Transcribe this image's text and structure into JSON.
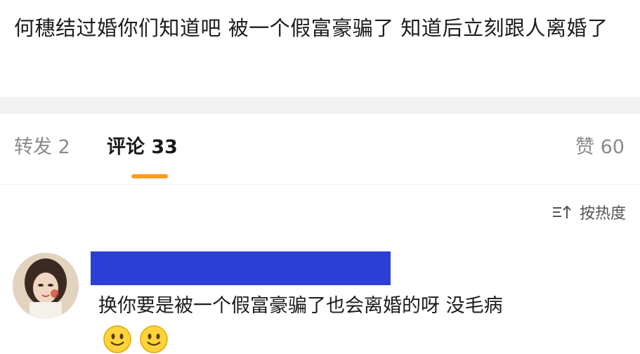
{
  "post": {
    "text": "何穗结过婚你们知道吧  被一个假富豪骗了  知道后立刻跟人离婚了"
  },
  "tabs": {
    "repost": "转发 2",
    "comment": "评论 33",
    "like": "赞 60"
  },
  "sort": {
    "label": "按热度",
    "icon": "sort-icon"
  },
  "comment": {
    "text": "换你要是被一个假富豪骗了也会离婚的呀 没毛病",
    "emojis": [
      "smile-emoji",
      "smile-emoji"
    ]
  },
  "colors": {
    "accent": "#ff9a1e",
    "redaction": "#2b3fd6",
    "separator": "#f2f2f2"
  }
}
